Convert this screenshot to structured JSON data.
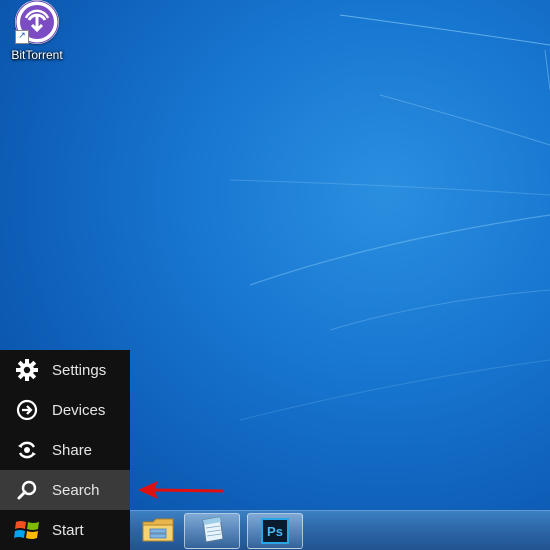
{
  "desktop": {
    "icons": [
      {
        "label": "BitTorrent",
        "icon": "bittorrent-icon"
      }
    ]
  },
  "charms": {
    "items": [
      {
        "label": "Settings",
        "icon": "gear-icon"
      },
      {
        "label": "Devices",
        "icon": "devices-icon"
      },
      {
        "label": "Share",
        "icon": "share-icon"
      },
      {
        "label": "Search",
        "icon": "search-icon",
        "active": true
      },
      {
        "label": "Start",
        "icon": "windows-logo-icon"
      }
    ]
  },
  "taskbar": {
    "apps": [
      {
        "icon": "file-explorer-icon"
      },
      {
        "icon": "notepad-icon"
      },
      {
        "icon": "photoshop-icon",
        "text": "Ps"
      }
    ]
  },
  "annotation": {
    "icon": "red-arrow-icon",
    "color": "#e01010"
  }
}
